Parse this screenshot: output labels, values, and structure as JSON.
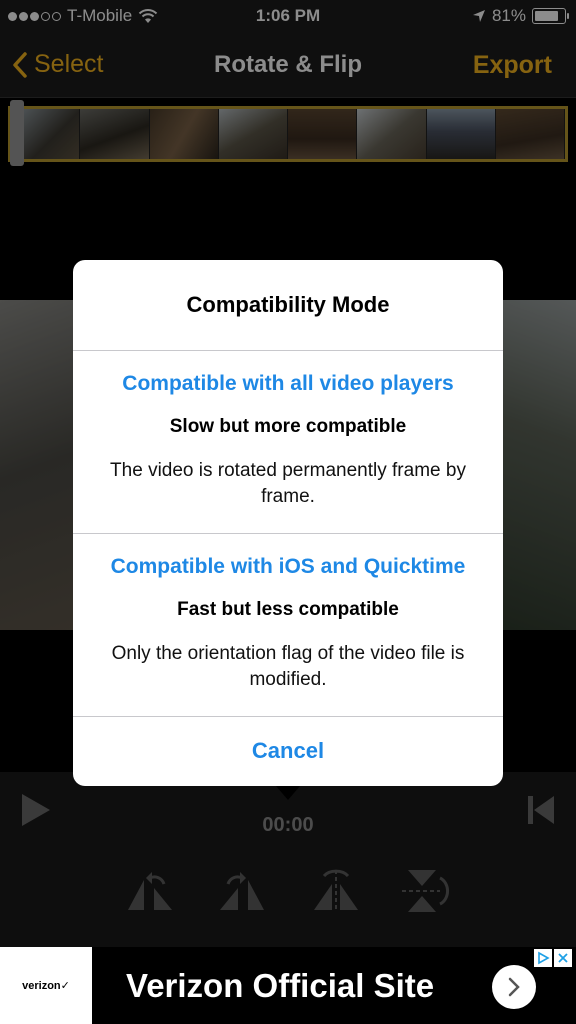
{
  "status_bar": {
    "carrier": "T-Mobile",
    "time": "1:06 PM",
    "battery": "81%",
    "battery_level": 0.81
  },
  "nav": {
    "back_label": "Select",
    "title": "Rotate & Flip",
    "export_label": "Export",
    "accent_color": "#f5b41e"
  },
  "dialog": {
    "title": "Compatibility Mode",
    "options": [
      {
        "title": "Compatible with all video players",
        "subtitle": "Slow but more compatible",
        "description": "The video is rotated permanently frame by frame."
      },
      {
        "title": "Compatible with iOS and Quicktime",
        "subtitle": "Fast but less compatible",
        "description": "Only the orientation flag of the video file is modified."
      }
    ],
    "cancel_label": "Cancel",
    "link_color": "#1e88e5"
  },
  "player": {
    "time": "00:00"
  },
  "tools": [
    "rotate-left-icon",
    "rotate-right-icon",
    "flip-horizontal-icon",
    "flip-vertical-icon"
  ],
  "ad": {
    "brand": "verizon✓",
    "text": "Verizon Official Site"
  }
}
